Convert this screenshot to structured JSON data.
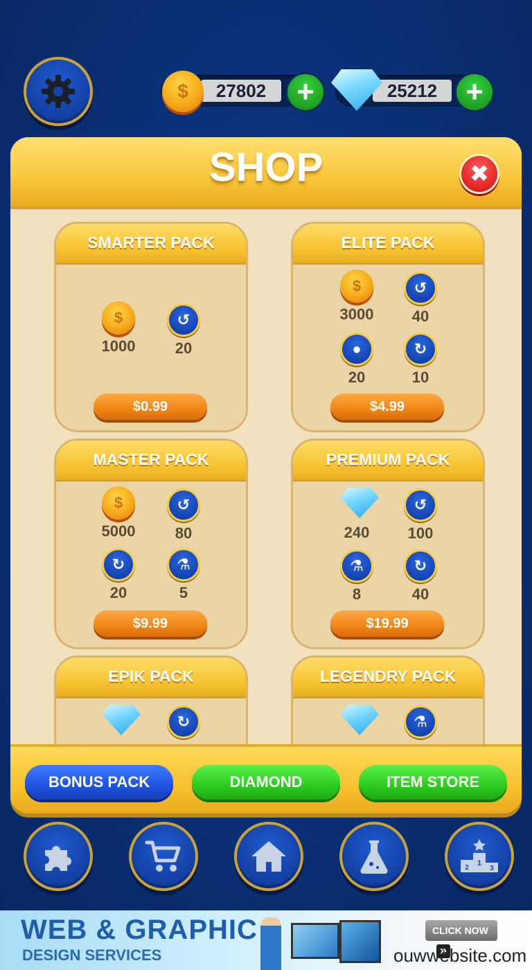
{
  "header": {
    "coins": "27802",
    "diamonds": "25212",
    "icons": [
      "gear-icon",
      "coin-icon",
      "diamond-icon",
      "plus-icon"
    ]
  },
  "shop": {
    "title": "SHOP",
    "close_symbol": "✖",
    "packs": [
      {
        "name": "SMARTER PACK",
        "price": "$0.99",
        "items": [
          {
            "icon": "coin-icon",
            "qty": "1000"
          },
          {
            "icon": "undo-icon",
            "qty": "20"
          }
        ]
      },
      {
        "name": "ELITE PACK",
        "price": "$4.99",
        "items": [
          {
            "icon": "coin-icon",
            "qty": "3000"
          },
          {
            "icon": "undo-icon",
            "qty": "40"
          },
          {
            "icon": "hint-bulb-icon",
            "qty": "20"
          },
          {
            "icon": "refresh-icon",
            "qty": "10"
          }
        ]
      },
      {
        "name": "MASTER PACK",
        "price": "$9.99",
        "items": [
          {
            "icon": "coin-icon",
            "qty": "5000"
          },
          {
            "icon": "undo-icon",
            "qty": "80"
          },
          {
            "icon": "refresh-icon",
            "qty": "20"
          },
          {
            "icon": "flask-icon",
            "qty": "5"
          }
        ]
      },
      {
        "name": "PREMIUM PACK",
        "price": "$19.99",
        "items": [
          {
            "icon": "diamond-icon",
            "qty": "240"
          },
          {
            "icon": "undo-icon",
            "qty": "100"
          },
          {
            "icon": "flask-icon",
            "qty": "8"
          },
          {
            "icon": "refresh-icon",
            "qty": "40"
          }
        ]
      },
      {
        "name": "EPIK PACK",
        "items": [
          {
            "icon": "diamond-icon"
          },
          {
            "icon": "refresh-icon"
          }
        ]
      },
      {
        "name": "LEGENDRY PACK",
        "items": [
          {
            "icon": "diamond-icon"
          },
          {
            "icon": "flask-icon"
          }
        ]
      }
    ],
    "tabs": [
      "BONUS PACK",
      "DIAMOND",
      "ITEM STORE"
    ]
  },
  "bottom_nav": {
    "icons": [
      "puzzle-icon",
      "cart-icon",
      "home-icon",
      "flask-icon",
      "leaderboard-icon"
    ]
  },
  "ad": {
    "headline": "WEB & GRAPHIC",
    "subline": "DESIGN SERVICES",
    "cta": "CLICK NOW",
    "cta_arrows": "»",
    "site": "ouwwebsite.com"
  },
  "colors": {
    "background": "#0a2f73",
    "panel": "#f1e1bf",
    "gold": "#f6c232",
    "price_orange": "#f08716",
    "tab_blue": "#1f54e0",
    "tab_green": "#2ccc1e"
  }
}
